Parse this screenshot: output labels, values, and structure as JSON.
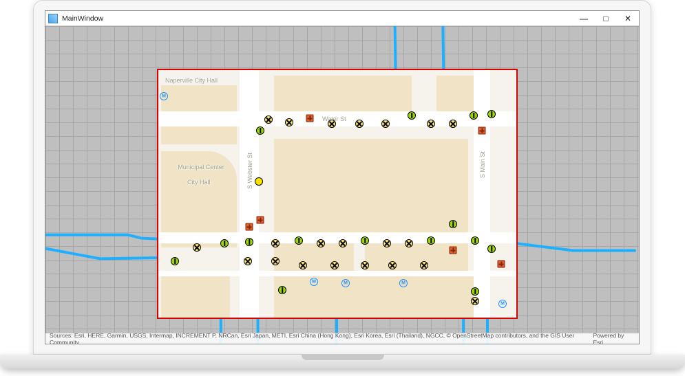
{
  "window": {
    "title": "MainWindow",
    "controls": {
      "minimize": "—",
      "maximize": "□",
      "close": "✕"
    }
  },
  "map": {
    "labels": {
      "city_hall": "Naperville City Hall",
      "municipal": "Municipal Center",
      "city_hall2": "City Hall",
      "water_st": "Water St",
      "s_webster": "S Webster St",
      "s_main": "S Main St"
    }
  },
  "attribution": {
    "sources": "Sources: Esri, HERE, Garmin, USGS, Intermap, INCREMENT P, NRCan, Esri Japan, METI, Esri China (Hong Kong), Esri Korea, Esri (Thailand), NGCC, © OpenStreetMap contributors, and the GIS User Community",
    "powered": "Powered by Esri"
  }
}
